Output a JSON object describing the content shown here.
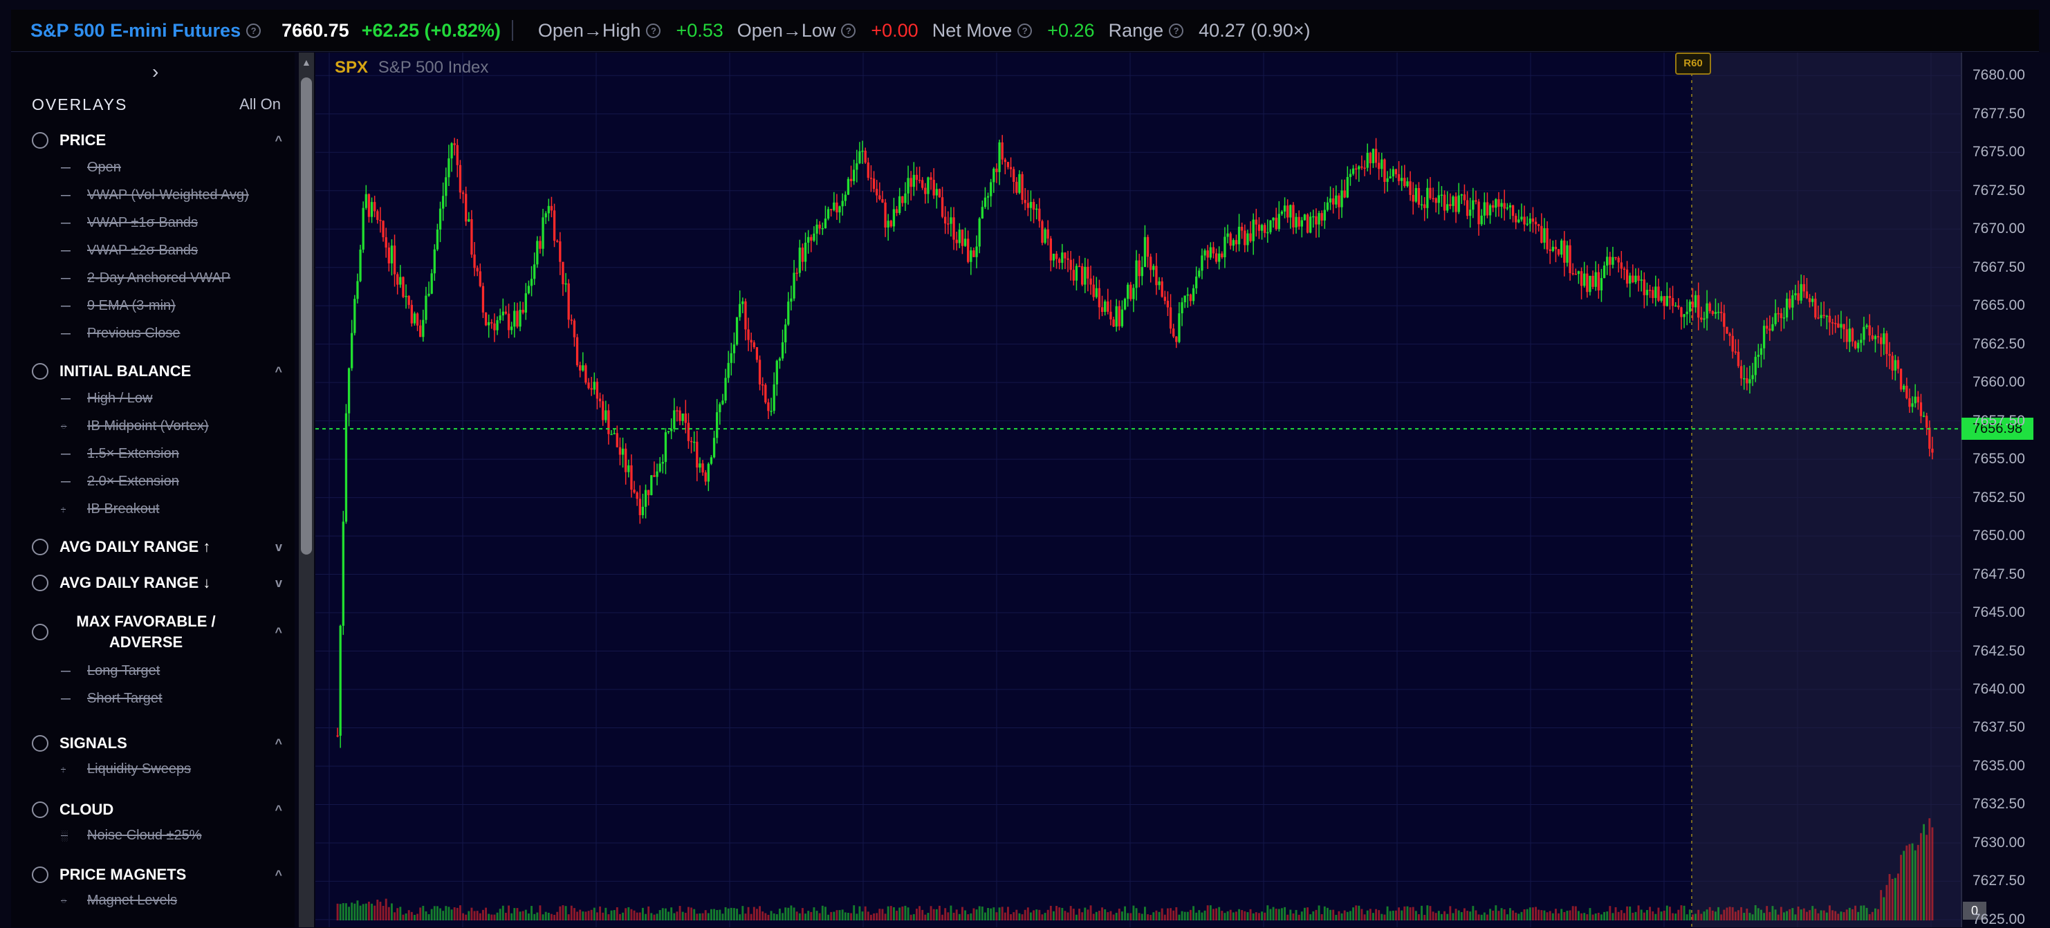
{
  "header": {
    "symbol": "S&P 500 E-mini Futures",
    "price": "7660.75",
    "change": "+62.25 (+0.82%)",
    "open_high_label": "Open→High",
    "open_high_value": "+0.53",
    "open_low_label": "Open→Low",
    "open_low_value": "+0.00",
    "net_move_label": "Net Move",
    "net_move_value": "+0.26",
    "range_label": "Range",
    "range_value": "40.27 (0.90×)",
    "help_glyph": "?"
  },
  "sidebar": {
    "collapse_glyph": "›",
    "title": "OVERLAYS",
    "all_on": "All On",
    "sections": [
      {
        "label": "PRICE",
        "chevron": "^",
        "items": [
          "Open",
          "VWAP (Vol-Weighted Avg)",
          "VWAP ±1σ Bands",
          "VWAP ±2σ Bands",
          "2-Day Anchored VWAP",
          "9 EMA (3-min)",
          "Previous Close"
        ]
      },
      {
        "label": "INITIAL BALANCE",
        "chevron": "^",
        "items": [
          "High / Low",
          "IB Midpoint (Vortex)",
          "1.5× Extension",
          "2.0× Extension",
          "IB Breakout"
        ]
      },
      {
        "label": "AVG DAILY RANGE ↑",
        "chevron": "v",
        "items": []
      },
      {
        "label": "AVG DAILY RANGE ↓",
        "chevron": "v",
        "items": []
      },
      {
        "label": "MAX FAVORABLE / ADVERSE",
        "chevron": "^",
        "items": [
          "Long Target",
          "Short Target"
        ]
      },
      {
        "label": "SIGNALS",
        "chevron": "^",
        "items": [
          "Liquidity Sweeps"
        ]
      },
      {
        "label": "CLOUD",
        "chevron": "^",
        "items": [
          "Noise Cloud ±25%"
        ]
      },
      {
        "label": "PRICE MAGNETS",
        "chevron": "^",
        "items": [
          "Magnet Levels"
        ]
      }
    ]
  },
  "chart": {
    "ticker": "SPX",
    "name": "S&P 500 Index",
    "marker_label": "R60",
    "last_price_tag": "7656.98",
    "volume_badge": "0"
  },
  "colors": {
    "bullish": "#22e030",
    "bearish": "#ff2a2a",
    "symbol": "#2f8ff0",
    "ticker": "#d6a514",
    "last_price_line": "#23e03a"
  },
  "chart_data": {
    "type": "candlestick",
    "title": "",
    "y_ticks": [
      "7680.00",
      "7677.50",
      "7675.00",
      "7672.50",
      "7670.00",
      "7667.50",
      "7665.00",
      "7662.50",
      "7660.00",
      "7657.50",
      "7655.00",
      "7652.50",
      "7650.00",
      "7647.50",
      "7645.00",
      "7642.50",
      "7640.00",
      "7637.50",
      "7635.00",
      "7632.50",
      "7630.00",
      "7627.50",
      "7625.00"
    ],
    "ylim": [
      7624.5,
      7681.5
    ],
    "last_price": 7656.98,
    "price_path_approx": [
      [
        0,
        7637.0
      ],
      [
        2,
        7660.0
      ],
      [
        6,
        7672.0
      ],
      [
        12,
        7668.0
      ],
      [
        18,
        7663.0
      ],
      [
        25,
        7676.0
      ],
      [
        32,
        7664.0
      ],
      [
        40,
        7664.0
      ],
      [
        46,
        7672.0
      ],
      [
        52,
        7662.0
      ],
      [
        58,
        7658.0
      ],
      [
        66,
        7652.0
      ],
      [
        74,
        7658.0
      ],
      [
        80,
        7654.0
      ],
      [
        88,
        7665.0
      ],
      [
        94,
        7658.0
      ],
      [
        100,
        7668.0
      ],
      [
        108,
        7671.0
      ],
      [
        114,
        7675.0
      ],
      [
        120,
        7670.0
      ],
      [
        126,
        7674.0
      ],
      [
        132,
        7671.0
      ],
      [
        138,
        7668.0
      ],
      [
        144,
        7675.0
      ],
      [
        150,
        7672.0
      ],
      [
        156,
        7668.0
      ],
      [
        162,
        7667.0
      ],
      [
        170,
        7664.0
      ],
      [
        176,
        7669.0
      ],
      [
        182,
        7663.0
      ],
      [
        188,
        7668.0
      ],
      [
        194,
        7669.0
      ],
      [
        200,
        7670.0
      ],
      [
        206,
        7671.0
      ],
      [
        212,
        7670.0
      ],
      [
        218,
        7672.0
      ],
      [
        224,
        7675.0
      ],
      [
        230,
        7673.0
      ],
      [
        236,
        7672.0
      ],
      [
        242,
        7672.0
      ],
      [
        248,
        7671.0
      ],
      [
        254,
        7672.0
      ],
      [
        260,
        7670.0
      ],
      [
        266,
        7669.0
      ],
      [
        272,
        7666.0
      ],
      [
        278,
        7668.0
      ],
      [
        284,
        7666.0
      ],
      [
        290,
        7665.0
      ],
      [
        296,
        7665.0
      ],
      [
        302,
        7664.0
      ],
      [
        306,
        7660.0
      ],
      [
        312,
        7664.0
      ],
      [
        318,
        7666.0
      ],
      [
        324,
        7664.0
      ],
      [
        330,
        7663.0
      ],
      [
        336,
        7663.0
      ],
      [
        340,
        7660.0
      ],
      [
        344,
        7658.0
      ],
      [
        347,
        7656.0
      ]
    ],
    "volume_spikes_near_end": true
  }
}
